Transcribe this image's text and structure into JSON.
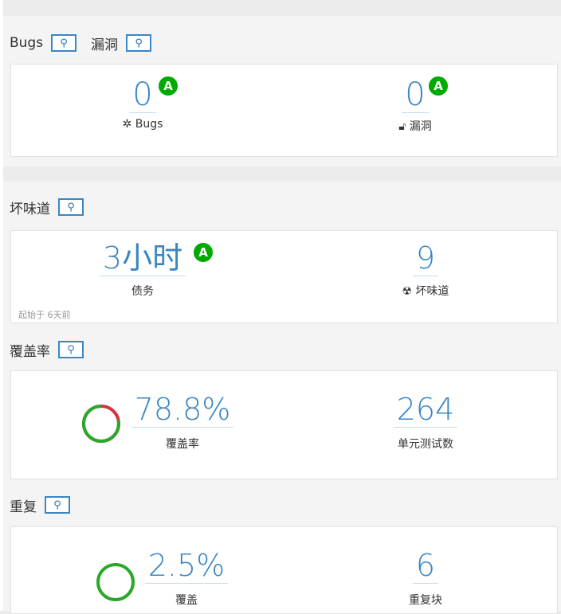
{
  "colors": {
    "link": "#3a86c4",
    "grade_a": "#00aa00",
    "coverage_good": "#2aa82a",
    "coverage_bad": "#d4333f"
  },
  "sections": {
    "bugs": {
      "title": "Bugs",
      "title2": "漏洞",
      "key_icon": "key-icon",
      "bugs": {
        "value": "0",
        "grade": "A",
        "icon": "bug-icon",
        "label": "Bugs"
      },
      "vulns": {
        "value": "0",
        "grade": "A",
        "icon": "lock-open-icon",
        "label": "漏洞"
      }
    },
    "smells": {
      "title": "坏味道",
      "debt": {
        "value": "3小时",
        "grade": "A",
        "label": "债务"
      },
      "smells": {
        "value": "9",
        "icon": "radiation-icon",
        "label": "坏味道"
      },
      "since": "起始于 6天前"
    },
    "coverage": {
      "title": "覆盖率",
      "coverage": {
        "value": "78.8%",
        "label": "覆盖率",
        "ratio": 0.788
      },
      "tests": {
        "value": "264",
        "label": "单元测试数"
      }
    },
    "dup": {
      "title": "重复",
      "dup": {
        "value": "2.5%",
        "label": "覆盖",
        "ratio": 0.025
      },
      "blocks": {
        "value": "6",
        "label": "重复块"
      }
    }
  }
}
